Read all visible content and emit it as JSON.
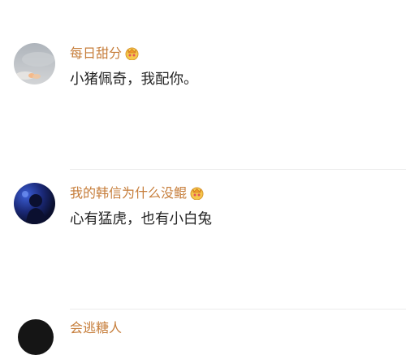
{
  "comments": [
    {
      "username": "每日甜分",
      "text": "小猪佩奇，我配你。",
      "avatar_icon": "cloud-sky-avatar"
    },
    {
      "username": "我的韩信为什么没鲲",
      "text": "心有猛虎，也有小白兔",
      "avatar_icon": "dark-blue-person-avatar"
    },
    {
      "username": "会逃糖人",
      "avatar_icon": "dark-avatar"
    }
  ],
  "badge_icon": "crown-vip-icon",
  "colors": {
    "username": "#c67d3a",
    "text": "#222222",
    "divider": "#ececec",
    "background": "#ffffff"
  }
}
